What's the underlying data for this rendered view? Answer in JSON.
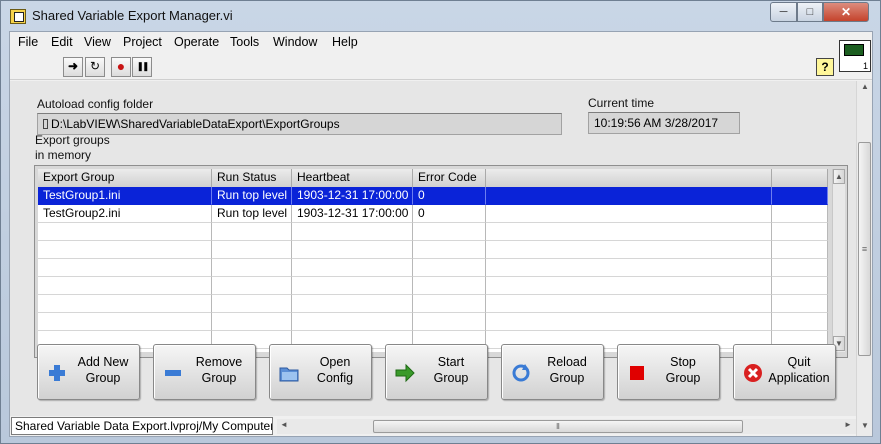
{
  "window": {
    "title": "Shared Variable Export Manager.vi",
    "min_icon": "─",
    "max_icon": "□",
    "close_icon": "✕"
  },
  "menu": [
    "File",
    "Edit",
    "View",
    "Project",
    "Operate",
    "Tools",
    "Window",
    "Help"
  ],
  "toolbar": {
    "run_icon": "➜",
    "continuous_run_icon": "↻",
    "abort_icon": "●",
    "pause_icon": "❚❚",
    "help_label": "?",
    "vi_icon_number": "1"
  },
  "panel": {
    "autoload_label": "Autoload config folder",
    "autoload_path": "D:\\LabVIEW\\SharedVariableDataExport\\ExportGroups",
    "current_time_label": "Current time",
    "current_time_value": "10:19:56 AM  3/28/2017",
    "groups_label": "Export groups\nin memory"
  },
  "table": {
    "columns": [
      "Export Group",
      "Run Status",
      "Heartbeat",
      "Error Code",
      "",
      ""
    ],
    "rows": [
      [
        "TestGroup1.ini",
        "Run top level",
        "1903-12-31  17:00:00",
        "0",
        "",
        ""
      ],
      [
        "TestGroup2.ini",
        "Run top level",
        "1903-12-31  17:00:00",
        "0",
        "",
        ""
      ],
      [
        "",
        "",
        "",
        "",
        "",
        ""
      ],
      [
        "",
        "",
        "",
        "",
        "",
        ""
      ],
      [
        "",
        "",
        "",
        "",
        "",
        ""
      ],
      [
        "",
        "",
        "",
        "",
        "",
        ""
      ],
      [
        "",
        "",
        "",
        "",
        "",
        ""
      ],
      [
        "",
        "",
        "",
        "",
        "",
        ""
      ],
      [
        "",
        "",
        "",
        "",
        "",
        ""
      ]
    ],
    "selected_row": 0
  },
  "buttons": [
    {
      "id": "add-new-group-button",
      "label": "Add New\nGroup",
      "icon": "plus-icon"
    },
    {
      "id": "remove-group-button",
      "label": "Remove\nGroup",
      "icon": "minus-icon"
    },
    {
      "id": "open-config-button",
      "label": "Open\nConfig",
      "icon": "folder-icon"
    },
    {
      "id": "start-group-button",
      "label": "Start\nGroup",
      "icon": "arrow-right-icon"
    },
    {
      "id": "reload-group-button",
      "label": "Reload\nGroup",
      "icon": "refresh-icon"
    },
    {
      "id": "stop-group-button",
      "label": "Stop\nGroup",
      "icon": "stop-square-icon"
    },
    {
      "id": "quit-application-button",
      "label": "Quit\nApplication",
      "icon": "close-circle-icon"
    }
  ],
  "statusbar": {
    "context": "Shared Variable Data Export.lvproj/My Computer",
    "left_arrow": "◄",
    "right_arrow": "►",
    "grip": "Ⅱ"
  },
  "colors": {
    "selection": "#0a23d8",
    "stop_red": "#e00000",
    "quit_red": "#d92020",
    "start_green": "#3a9a2a",
    "blue_icon": "#3a7bd5"
  }
}
